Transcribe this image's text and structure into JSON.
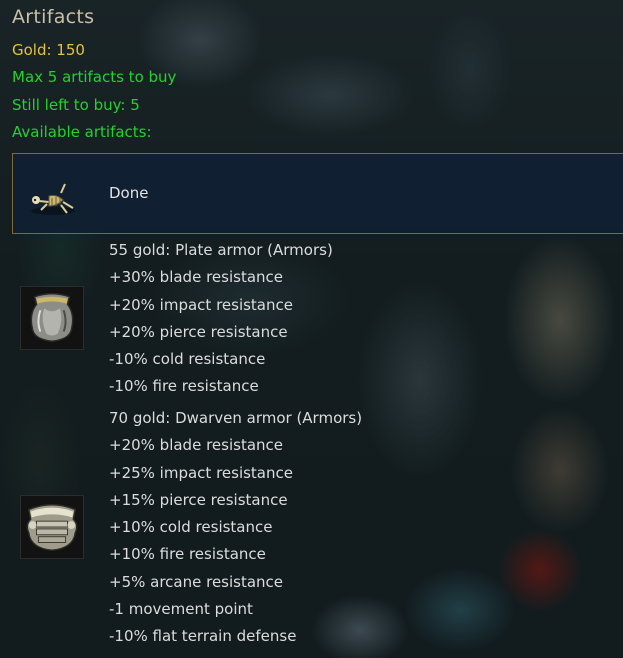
{
  "dialog": {
    "title": "Artifacts",
    "gold_line": "Gold: 150",
    "max_line": "Max 5 artifacts to buy",
    "left_line": "Still left to buy: 5",
    "available_line": "Available artifacts:"
  },
  "options": {
    "done": {
      "label": "Done",
      "icon": "skeleton-icon"
    },
    "items": [
      {
        "icon": "plate-armor-icon",
        "lines": [
          "55 gold: Plate armor (Armors)",
          "+30% blade resistance",
          "+20% impact resistance",
          "+20% pierce resistance",
          "-10% cold resistance",
          "-10% fire resistance"
        ]
      },
      {
        "icon": "dwarven-armor-icon",
        "lines": [
          "70 gold: Dwarven armor (Armors)",
          "+20% blade resistance",
          "+25% impact resistance",
          "+15% pierce resistance",
          "+10% cold resistance",
          "+10% fire resistance",
          "+5% arcane resistance",
          "-1 movement point",
          "-10% flat terrain defense"
        ]
      }
    ]
  },
  "colors": {
    "gold_text": "#e6c13a",
    "green_text": "#22d32a",
    "selection_border": "#7d6a3a",
    "selection_fill": "#102034"
  }
}
